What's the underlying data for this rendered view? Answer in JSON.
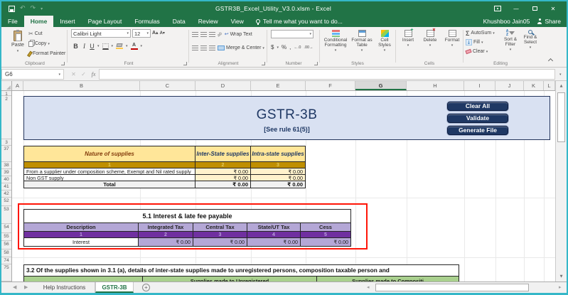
{
  "window": {
    "title": "GSTR3B_Excel_Utility_V3.0.xlsm - Excel",
    "user": "Khushboo Jain05",
    "share": "Share",
    "tell_me": "Tell me what you want to do..."
  },
  "ribbon_tabs": [
    "File",
    "Home",
    "Insert",
    "Page Layout",
    "Formulas",
    "Data",
    "Review",
    "View"
  ],
  "active_tab": "Home",
  "ribbon": {
    "clipboard": {
      "label": "Clipboard",
      "paste": "Paste",
      "cut": "Cut",
      "copy": "Copy",
      "format_painter": "Format Painter"
    },
    "font": {
      "label": "Font",
      "family": "Calibri Light",
      "size": "12",
      "bold": "B",
      "italic": "I",
      "underline": "U"
    },
    "alignment": {
      "label": "Alignment",
      "wrap_text": "Wrap Text",
      "merge_center": "Merge & Center"
    },
    "number": {
      "label": "Number",
      "format": "",
      "currency": "$",
      "percent": "%",
      "comma": ","
    },
    "styles": {
      "label": "Styles",
      "conditional": "Conditional Formatting",
      "format_table": "Format as Table",
      "cell_styles": "Cell Styles"
    },
    "cells": {
      "label": "Cells",
      "insert": "Insert",
      "delete": "Delete",
      "format": "Format"
    },
    "editing": {
      "label": "Editing",
      "autosum": "AutoSum",
      "fill": "Fill",
      "clear": "Clear",
      "sort_filter": "Sort & Filter",
      "find_select": "Find & Select"
    }
  },
  "formula_bar": {
    "name_box": "G6",
    "fx": "fx",
    "value": ""
  },
  "columns": [
    "A",
    "B",
    "C",
    "D",
    "E",
    "F",
    "G",
    "H",
    "I",
    "J",
    "K",
    "L"
  ],
  "selected_column": "G",
  "rows": [
    "1",
    "2",
    "3",
    "37",
    "38",
    "39",
    "40",
    "41",
    "42",
    "52",
    "53",
    "54",
    "55",
    "56",
    "58",
    "74",
    "75"
  ],
  "sheet": {
    "form": {
      "title": "GSTR-3B",
      "subtitle": "[See rule 61(5)]",
      "buttons": [
        "Clear All",
        "Validate",
        "Generate File"
      ]
    },
    "table1": {
      "headers": [
        "Nature of supplies",
        "Inter-State supplies",
        "Intra-state supplies"
      ],
      "index": [
        "1",
        "2",
        "3"
      ],
      "rows": [
        [
          "From a supplier under composition scheme, Exempt  and Nil rated supply",
          "₹ 0.00",
          "₹ 0.00"
        ],
        [
          "Non GST supply",
          "₹ 0.00",
          "₹ 0.00"
        ]
      ],
      "total": [
        "Total",
        "₹ 0.00",
        "₹ 0.00"
      ]
    },
    "section51": {
      "title": "5.1 Interest & late fee payable",
      "headers": [
        "Description",
        "Integrated Tax",
        "Central Tax",
        "State/UT Tax",
        "Cess"
      ],
      "index": [
        "1",
        "2",
        "3",
        "4",
        "5"
      ],
      "row": [
        "Interest",
        "₹ 0.00",
        "₹ 0.00",
        "₹ 0.00",
        "₹ 0.00"
      ]
    },
    "section32": {
      "text": "3.2  Of the supplies shown in 3.1 (a), details of inter-state supplies made to unregistered persons, composition taxable person and",
      "cols": [
        "",
        "Supplies made to Unregistered",
        "Supplies made to Compositi"
      ]
    }
  },
  "sheet_tabs": [
    "Help Instructions",
    "GSTR-3B"
  ],
  "active_sheet": "GSTR-3B",
  "colors": {
    "excel_green": "#217346",
    "window_border": "#35B7C8",
    "form_header_bg": "#D9E1F2",
    "form_text": "#1F3864",
    "action_button_bg": "#1F3864",
    "table1_header_bg": "#FFE699",
    "table1_band_bg": "#BF8F00",
    "amount_cell_bg": "#FFF2CC",
    "purple_header_bg": "#B4A7D6",
    "purple_band_bg": "#7030A0",
    "highlight_border": "#FF0000",
    "green_header_bg": "#A9D08E"
  }
}
